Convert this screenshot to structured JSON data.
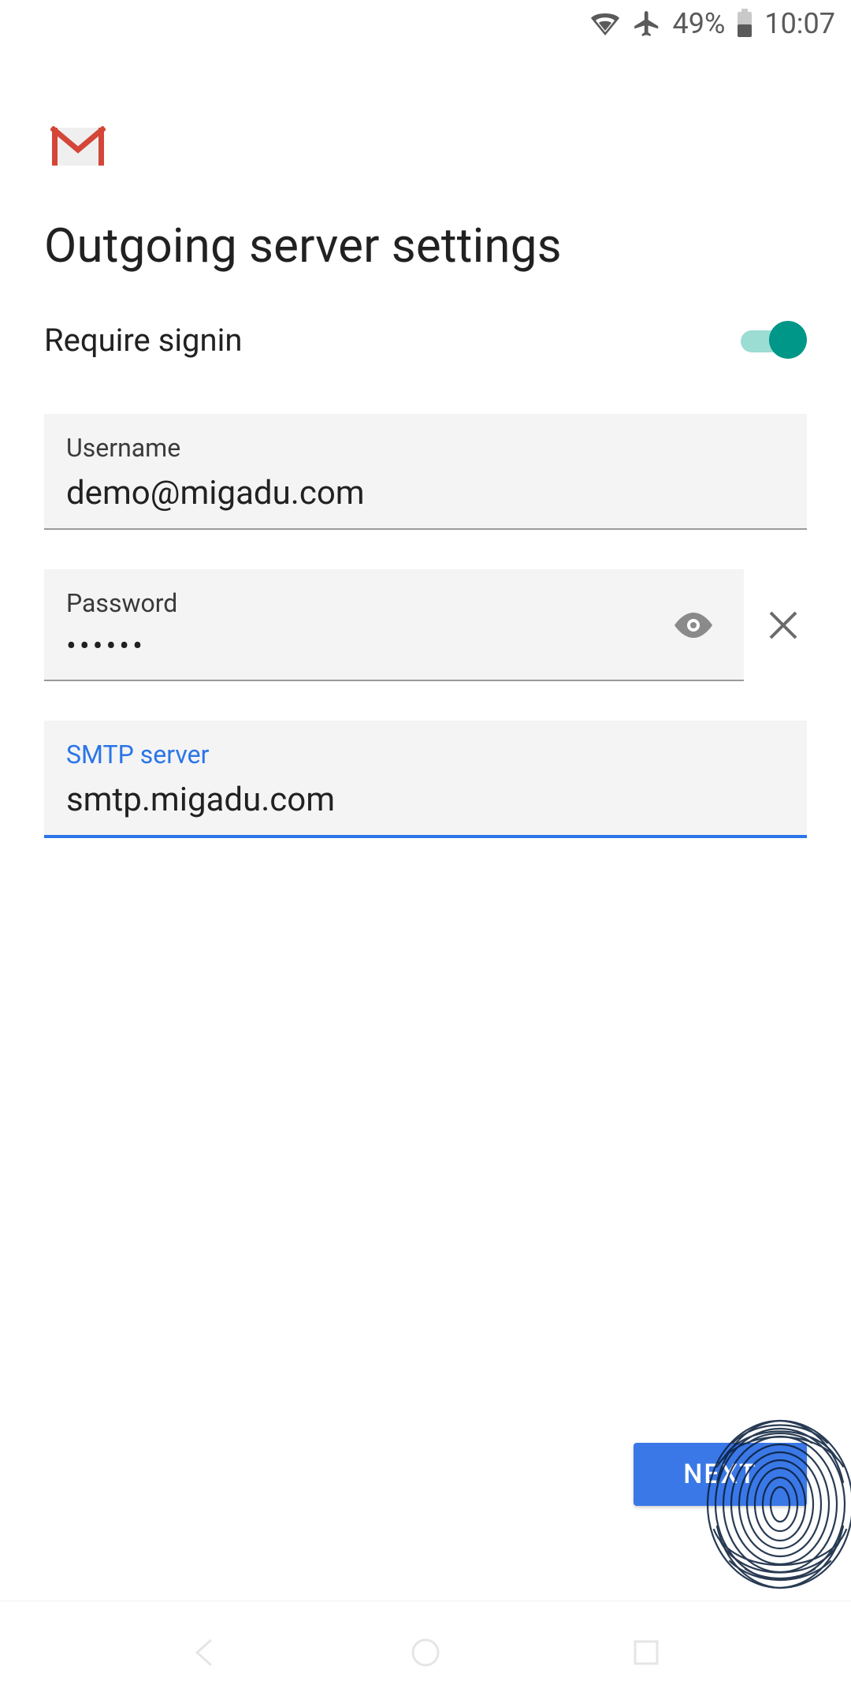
{
  "status_bar": {
    "battery_pct_label": "49%",
    "time": "10:07"
  },
  "page_title": "Outgoing server settings",
  "require_signin": {
    "label": "Require signin",
    "enabled": true
  },
  "fields": {
    "username": {
      "label": "Username",
      "value": "demo@migadu.com"
    },
    "password": {
      "label": "Password",
      "masked_value": "••••••"
    },
    "smtp_server": {
      "label": "SMTP server",
      "value": "smtp.migadu.com"
    }
  },
  "next_button_label": "NEXT"
}
